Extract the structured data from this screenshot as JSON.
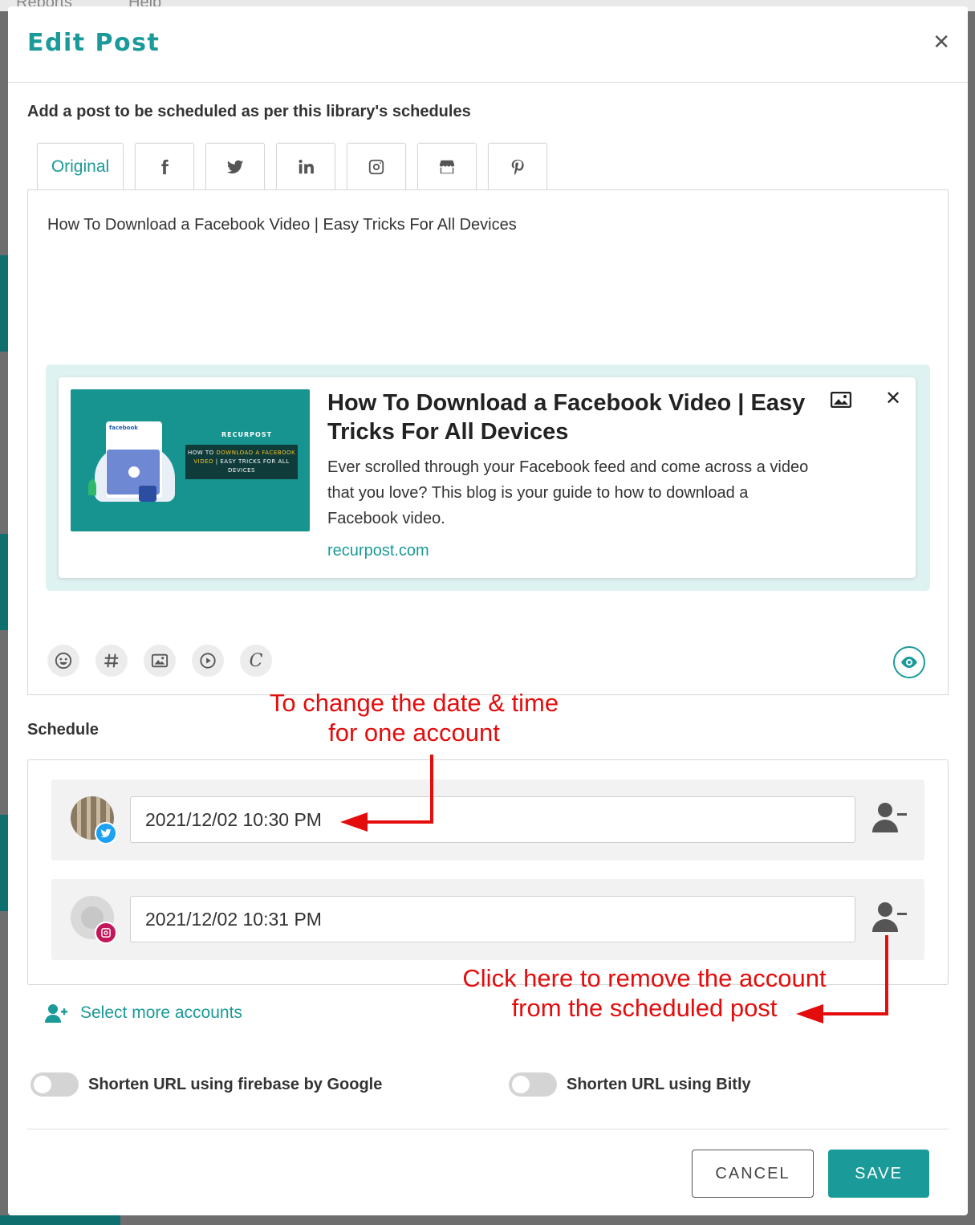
{
  "background": {
    "menu_items": [
      "Reports",
      "Help"
    ]
  },
  "modal": {
    "title": "Edit Post",
    "subtitle": "Add a post to be scheduled as per this library's schedules"
  },
  "tabs": [
    {
      "label": "Original",
      "active": true
    },
    {
      "icon": "facebook-icon"
    },
    {
      "icon": "twitter-icon"
    },
    {
      "icon": "linkedin-icon"
    },
    {
      "icon": "instagram-icon"
    },
    {
      "icon": "google-business-icon"
    },
    {
      "icon": "pinterest-icon"
    }
  ],
  "editor": {
    "post_text": "How To Download a Facebook Video | Easy Tricks For All Devices",
    "link_preview": {
      "title": "How To Download a Facebook Video | Easy Tricks For All Devices",
      "description": "Ever scrolled through your Facebook feed and come across a video that you love? This blog is your guide to how to download a Facebook video.",
      "domain": "recurpost.com",
      "thumbnail": {
        "phone_label": "facebook",
        "brand": "RECURPOST",
        "banner_line1": "HOW TO",
        "banner_highlight": "DOWNLOAD A FACEBOOK VIDEO",
        "banner_line3": "| EASY TRICKS FOR ALL DEVICES"
      }
    },
    "toolbar": [
      "emoji-icon",
      "hashtag-icon",
      "image-icon",
      "video-icon",
      "canva-icon"
    ],
    "preview_icon": "eye-icon"
  },
  "schedule": {
    "label": "Schedule",
    "accounts": [
      {
        "network": "twitter",
        "datetime": "2021/12/02 10:30 PM"
      },
      {
        "network": "instagram",
        "datetime": "2021/12/02 10:31 PM"
      }
    ],
    "select_more": "Select more accounts"
  },
  "options": {
    "firebase_label": "Shorten URL using firebase by Google",
    "bitly_label": "Shorten URL using Bitly"
  },
  "footer": {
    "cancel_label": "CANCEL",
    "save_label": "SAVE"
  },
  "annotations": {
    "date_time_line1": "To change the date & time",
    "date_time_line2": "for one account",
    "remove_line1": "Click here to remove the account",
    "remove_line2": "from the scheduled post"
  },
  "colors": {
    "accent": "#1a9a98",
    "annotation": "#e30d0d",
    "twitter": "#1da1f2",
    "instagram": "#c2185b"
  }
}
